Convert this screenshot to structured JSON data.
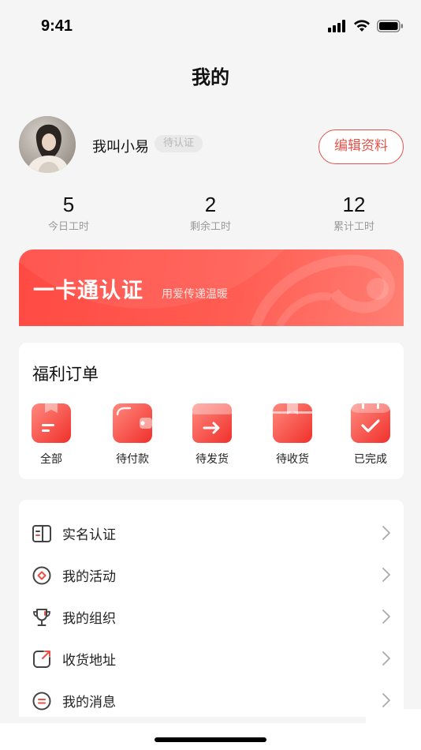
{
  "status_bar": {
    "time": "9:41"
  },
  "header": {
    "title": "我的"
  },
  "profile": {
    "name": "我叫小易",
    "auth_status": "待认证",
    "edit_label": "编辑资料"
  },
  "stats": [
    {
      "value": "5",
      "label": "今日工时"
    },
    {
      "value": "2",
      "label": "剩余工时"
    },
    {
      "value": "12",
      "label": "累计工时"
    }
  ],
  "banner": {
    "title": "一卡通认证",
    "subtitle": "用爱传递温暖"
  },
  "orders": {
    "title": "福利订单",
    "items": [
      {
        "label": "全部",
        "icon": "all-orders-icon"
      },
      {
        "label": "待付款",
        "icon": "wallet-icon"
      },
      {
        "label": "待发货",
        "icon": "box-arrow-icon"
      },
      {
        "label": "待收货",
        "icon": "package-icon"
      },
      {
        "label": "已完成",
        "icon": "calendar-check-icon"
      }
    ]
  },
  "menu": {
    "items": [
      {
        "label": "实名认证",
        "icon": "id-card-icon"
      },
      {
        "label": "我的活动",
        "icon": "activity-icon"
      },
      {
        "label": "我的组织",
        "icon": "trophy-icon"
      },
      {
        "label": "收货地址",
        "icon": "address-icon"
      },
      {
        "label": "我的消息",
        "icon": "message-icon"
      }
    ]
  },
  "colors": {
    "accent": "#e4524a",
    "banner_start": "#ff4a43",
    "banner_end": "#ff7e73"
  }
}
